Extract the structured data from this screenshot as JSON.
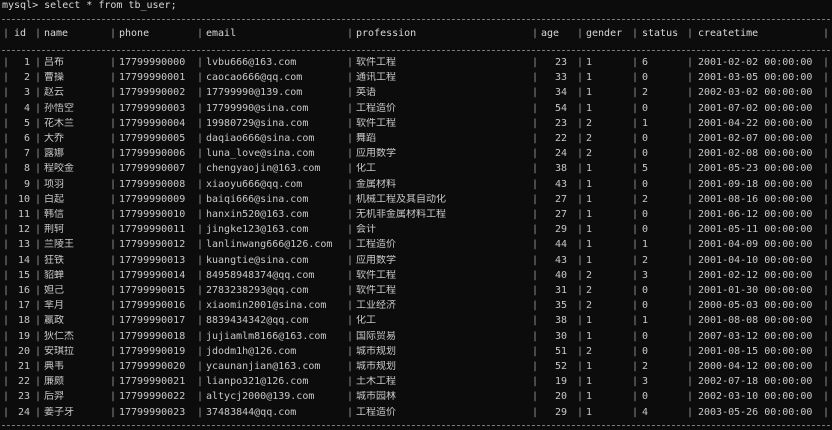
{
  "prompt": "mysql> select * from tb_user;",
  "columns": [
    "id",
    "name",
    "phone",
    "email",
    "profession",
    "age",
    "gender",
    "status",
    "createtime"
  ],
  "rows": [
    [
      "1",
      "吕布",
      "17799990000",
      "lvbu666@163.com",
      "软件工程",
      "23",
      "1",
      "6",
      "2001-02-02 00:00:00"
    ],
    [
      "2",
      "曹操",
      "17799990001",
      "caocao666@qq.com",
      "通讯工程",
      "33",
      "1",
      "0",
      "2001-03-05 00:00:00"
    ],
    [
      "3",
      "赵云",
      "17799990002",
      "17799990@139.com",
      "英语",
      "34",
      "1",
      "2",
      "2002-03-02 00:00:00"
    ],
    [
      "4",
      "孙悟空",
      "17799990003",
      "17799990@sina.com",
      "工程造价",
      "54",
      "1",
      "0",
      "2001-07-02 00:00:00"
    ],
    [
      "5",
      "花木兰",
      "17799990004",
      "19980729@sina.com",
      "软件工程",
      "23",
      "2",
      "1",
      "2001-04-22 00:00:00"
    ],
    [
      "6",
      "大乔",
      "17799990005",
      "daqiao666@sina.com",
      "舞蹈",
      "22",
      "2",
      "0",
      "2001-02-07 00:00:00"
    ],
    [
      "7",
      "露娜",
      "17799990006",
      "luna_love@sina.com",
      "应用数学",
      "24",
      "2",
      "0",
      "2001-02-08 00:00:00"
    ],
    [
      "8",
      "程咬金",
      "17799990007",
      "chengyaojin@163.com",
      "化工",
      "38",
      "1",
      "5",
      "2001-05-23 00:00:00"
    ],
    [
      "9",
      "项羽",
      "17799990008",
      "xiaoyu666@qq.com",
      "金属材料",
      "43",
      "1",
      "0",
      "2001-09-18 00:00:00"
    ],
    [
      "10",
      "白起",
      "17799990009",
      "baiqi666@sina.com",
      "机械工程及其自动化",
      "27",
      "1",
      "2",
      "2001-08-16 00:00:00"
    ],
    [
      "11",
      "韩信",
      "17799990010",
      "hanxin520@163.com",
      "无机非金属材料工程",
      "27",
      "1",
      "0",
      "2001-06-12 00:00:00"
    ],
    [
      "12",
      "荆轲",
      "17799990011",
      "jingke123@163.com",
      "会计",
      "29",
      "1",
      "0",
      "2001-05-11 00:00:00"
    ],
    [
      "13",
      "兰陵王",
      "17799990012",
      "lanlinwang666@126.com",
      "工程造价",
      "44",
      "1",
      "1",
      "2001-04-09 00:00:00"
    ],
    [
      "14",
      "狂铁",
      "17799990013",
      "kuangtie@sina.com",
      "应用数学",
      "43",
      "1",
      "2",
      "2001-04-10 00:00:00"
    ],
    [
      "15",
      "貂蝉",
      "17799990014",
      "84958948374@qq.com",
      "软件工程",
      "40",
      "2",
      "3",
      "2001-02-12 00:00:00"
    ],
    [
      "16",
      "妲己",
      "17799990015",
      "2783238293@qq.com",
      "软件工程",
      "31",
      "2",
      "0",
      "2001-01-30 00:00:00"
    ],
    [
      "17",
      "芈月",
      "17799990016",
      "xiaomin2001@sina.com",
      "工业经济",
      "35",
      "2",
      "0",
      "2000-05-03 00:00:00"
    ],
    [
      "18",
      "嬴政",
      "17799990017",
      "8839434342@qq.com",
      "化工",
      "38",
      "1",
      "1",
      "2001-08-08 00:00:00"
    ],
    [
      "19",
      "狄仁杰",
      "17799990018",
      "jujiamlm8166@163.com",
      "国际贸易",
      "30",
      "1",
      "0",
      "2007-03-12 00:00:00"
    ],
    [
      "20",
      "安琪拉",
      "17799990019",
      "jdodm1h@126.com",
      "城市规划",
      "51",
      "2",
      "0",
      "2001-08-15 00:00:00"
    ],
    [
      "21",
      "典韦",
      "17799990020",
      "ycaunanjian@163.com",
      "城市规划",
      "52",
      "1",
      "2",
      "2000-04-12 00:00:00"
    ],
    [
      "22",
      "廉颇",
      "17799990021",
      "lianpo321@126.com",
      "土木工程",
      "19",
      "1",
      "3",
      "2002-07-18 00:00:00"
    ],
    [
      "23",
      "后羿",
      "17799990022",
      "altycj2000@139.com",
      "城市园林",
      "20",
      "1",
      "0",
      "2002-03-10 00:00:00"
    ],
    [
      "24",
      "姜子牙",
      "17799990023",
      "37483844@qq.com",
      "工程造价",
      "29",
      "1",
      "4",
      "2003-05-26 00:00:00"
    ]
  ]
}
